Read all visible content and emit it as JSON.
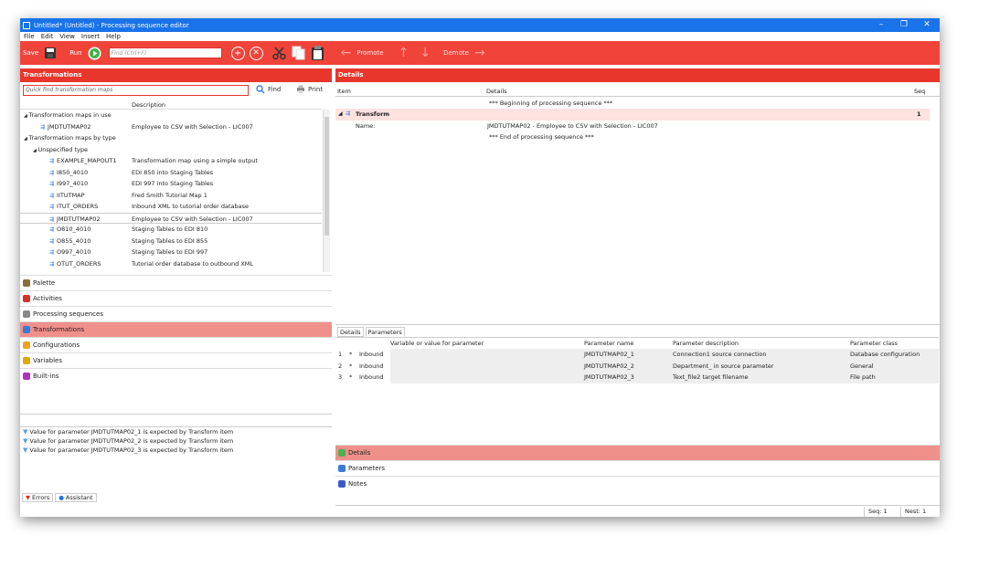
{
  "window": {
    "title": "Untitled* (Untitled) - Processing sequence editor"
  },
  "menu": [
    "File",
    "Edit",
    "View",
    "Insert",
    "Help"
  ],
  "toolbar": {
    "save": "Save",
    "run": "Run",
    "find_placeholder": "Find (Ctrl+F)",
    "promote": "Promote",
    "demote": "Demote"
  },
  "transformations_panel": {
    "title": "Transformations",
    "quick_find_placeholder": "Quick find transformation maps",
    "find": "Find",
    "print": "Print",
    "col_description": "Description",
    "rows": [
      {
        "name": "Transformation maps in use",
        "desc": "",
        "level": 0,
        "group": true
      },
      {
        "name": "JMDTUTMAP02",
        "desc": "Employee to CSV with Selection - LIC007",
        "level": 1,
        "group": false
      },
      {
        "name": "Transformation maps by type",
        "desc": "",
        "level": 0,
        "group": true
      },
      {
        "name": "Unspecified type",
        "desc": "",
        "level": 1,
        "group": true
      },
      {
        "name": "EXAMPLE_MAPOUT1",
        "desc": "Transformation map using a simple output",
        "level": 2,
        "group": false
      },
      {
        "name": "I850_4010",
        "desc": "EDI 850 into Staging Tables",
        "level": 2,
        "group": false
      },
      {
        "name": "I997_4010",
        "desc": "EDI 997 into Staging Tables",
        "level": 2,
        "group": false
      },
      {
        "name": "IITUTMAP",
        "desc": "Fred Smith Tutorial Map 1",
        "level": 2,
        "group": false
      },
      {
        "name": "ITUT_ORDERS",
        "desc": "Inbound XML to tutorial order database",
        "level": 2,
        "group": false
      },
      {
        "name": "JMDTUTMAP02",
        "desc": "Employee to CSV with Selection - LIC007",
        "level": 2,
        "group": false,
        "selected": true
      },
      {
        "name": "O810_4010",
        "desc": "Staging Tables to EDI 810",
        "level": 2,
        "group": false
      },
      {
        "name": "O855_4010",
        "desc": "Staging Tables to EDI 855",
        "level": 2,
        "group": false
      },
      {
        "name": "O997_4010",
        "desc": "Staging Tables to EDI 997",
        "level": 2,
        "group": false
      },
      {
        "name": "OTUT_ORDERS",
        "desc": "Tutorial order database to outbound XML",
        "level": 2,
        "group": false
      }
    ]
  },
  "nav_items": [
    {
      "label": "Palette",
      "icon": "palette-icon",
      "color": "#8a6d3b"
    },
    {
      "label": "Activities",
      "icon": "activities-icon",
      "color": "#d93025"
    },
    {
      "label": "Processing sequences",
      "icon": "sequence-icon",
      "color": "#888888"
    },
    {
      "label": "Transformations",
      "icon": "transform-icon",
      "color": "#3a7bd5",
      "active": true
    },
    {
      "label": "Configurations",
      "icon": "configuration-icon",
      "color": "#f0a020"
    },
    {
      "label": "Variables",
      "icon": "variables-icon",
      "color": "#e0a800"
    },
    {
      "label": "Built-ins",
      "icon": "builtins-icon",
      "color": "#b030c0"
    }
  ],
  "messages": [
    "Value for parameter JMDTUTMAP02_1 is expected by Transform item",
    "Value for parameter JMDTUTMAP02_2 is expected by Transform item",
    "Value for parameter JMDTUTMAP02_3 is expected by Transform item"
  ],
  "bottom_tabs": [
    "Errors",
    "Assistant"
  ],
  "details_panel": {
    "title": "Details",
    "columns": {
      "item": "Item",
      "details": "Details",
      "seq": "Seq"
    },
    "begin": "*** Beginning of processing sequence ***",
    "transform_label": "Transform",
    "transform_seq": "1",
    "name_label": "Name:",
    "name_value": "JMDTUTMAP02 - Employee to CSV with Selection - LIC007",
    "end": "*** End of processing sequence ***"
  },
  "param_tabs": [
    "Details",
    "Parameters"
  ],
  "param_table": {
    "columns": [
      "Variable or value for parameter",
      "Parameter name",
      "Parameter description",
      "Parameter class"
    ],
    "rows": [
      {
        "num": "1",
        "dir": "Inbound",
        "value": "",
        "name": "JMDTUTMAP02_1",
        "desc": "Connection1 source connection",
        "class": "Database configuration"
      },
      {
        "num": "2",
        "dir": "Inbound",
        "value": "",
        "name": "JMDTUTMAP02_2",
        "desc": "Department_ in source parameter",
        "class": "General"
      },
      {
        "num": "3",
        "dir": "Inbound",
        "value": "",
        "name": "JMDTUTMAP02_3",
        "desc": "Text_file2 target filename",
        "class": "File path"
      }
    ]
  },
  "right_nav": [
    {
      "label": "Details",
      "icon": "details-icon",
      "color": "#4caf50",
      "active": true
    },
    {
      "label": "Parameters",
      "icon": "parameters-icon",
      "color": "#3a7bd5"
    },
    {
      "label": "Notes",
      "icon": "notes-icon",
      "color": "#3a5bc5"
    }
  ],
  "status": {
    "seq": "Seq: 1",
    "nest": "Nest: 1"
  }
}
